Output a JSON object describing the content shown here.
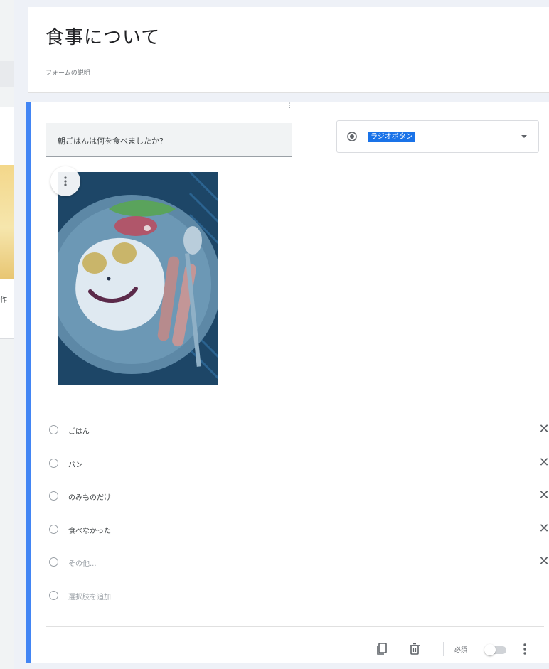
{
  "form": {
    "title": "食事について",
    "description": "フォームの説明"
  },
  "question": {
    "text": "朝ごはんは何を食べましたか?",
    "type_label": "ラジオボタン",
    "options": [
      {
        "label": "ごはん"
      },
      {
        "label": "パン"
      },
      {
        "label": "のみものだけ"
      },
      {
        "label": "食べなかった"
      }
    ],
    "other_label": "その他...",
    "add_option_label": "選択肢を追加"
  },
  "footer": {
    "required_label": "必須"
  },
  "left_panel": {
    "fragment": "作"
  },
  "colors": {
    "accent": "#4285f4",
    "selection": "#1a73e8",
    "background": "#eef1f7"
  },
  "icons": {
    "drag": "drag-handle-icon",
    "type": "radio-checked-icon",
    "dropdown": "dropdown-arrow-icon",
    "remove": "close-icon",
    "copy": "copy-icon",
    "delete": "trash-icon",
    "more": "more-vert-icon"
  }
}
